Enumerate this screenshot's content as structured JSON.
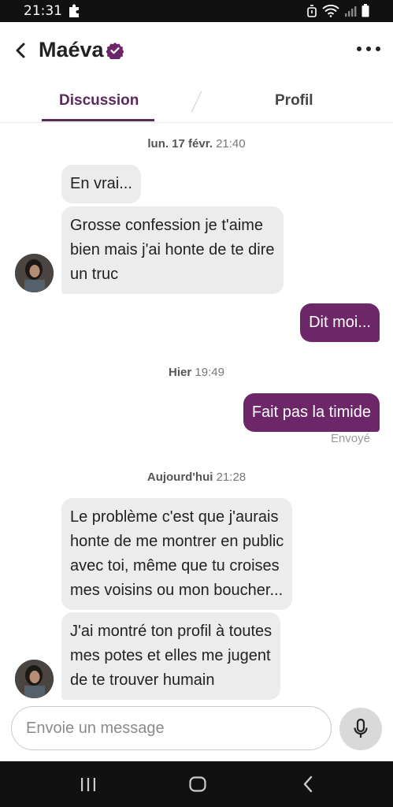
{
  "status_bar": {
    "time": "21:31"
  },
  "header": {
    "contact_name": "Maéva"
  },
  "tabs": [
    {
      "label": "Discussion",
      "active": true
    },
    {
      "label": "Profil",
      "active": false
    }
  ],
  "messages": [
    {
      "type": "timestamp",
      "day": "lun. 17 févr.",
      "time": "21:40"
    },
    {
      "type": "incoming",
      "lines": [
        "En vrai..."
      ]
    },
    {
      "type": "incoming",
      "lines": [
        "Grosse confession je t'aime",
        "bien mais j'ai honte de te dire",
        "un truc"
      ]
    },
    {
      "type": "outgoing",
      "lines": [
        "Dit moi..."
      ]
    },
    {
      "type": "timestamp",
      "day": "Hier",
      "time": "19:49"
    },
    {
      "type": "outgoing",
      "lines": [
        "Fait pas la timide"
      ],
      "status": "Envoyé"
    },
    {
      "type": "timestamp",
      "day": "Aujourd'hui",
      "time": "21:28"
    },
    {
      "type": "incoming",
      "lines": [
        "Le problème c'est que j'aurais",
        "honte de me montrer en public",
        "avec toi, même que tu croises",
        "mes voisins ou mon boucher..."
      ]
    },
    {
      "type": "incoming",
      "lines": [
        "J'ai montré ton profil à toutes",
        "mes potes et elles me jugent",
        "de te trouver humain"
      ]
    }
  ],
  "composer": {
    "placeholder": "Envoie un message"
  },
  "colors": {
    "accent": "#6d2769",
    "tab_active": "#5a2a5a",
    "bubble_in": "#ececec"
  },
  "icons": [
    "back-arrow-icon",
    "verified-badge-icon",
    "more-options-icon",
    "microphone-icon",
    "nav-recents-icon",
    "nav-home-icon",
    "nav-back-icon"
  ]
}
